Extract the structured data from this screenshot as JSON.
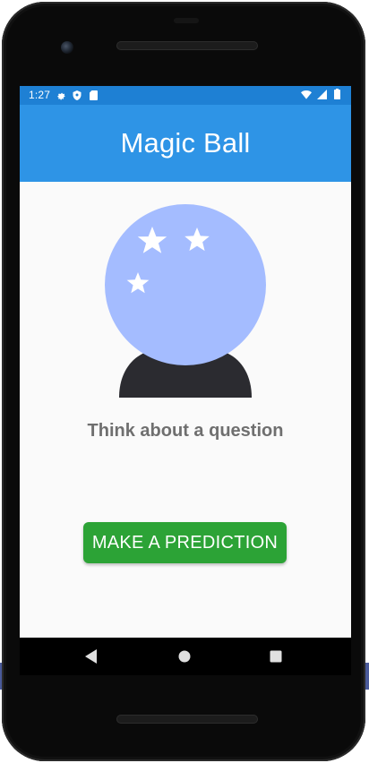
{
  "status_bar": {
    "time": "1:27",
    "left_icons": [
      "gear-icon",
      "shield-icon",
      "sd-card-icon"
    ],
    "right_icons": [
      "wifi-icon",
      "cell-signal-icon",
      "battery-icon"
    ]
  },
  "app_bar": {
    "title": "Magic Ball"
  },
  "main": {
    "image_icon": "crystal-ball-icon",
    "prompt": "Think about a question",
    "prediction_button_label": "MAKE A PREDICTION"
  },
  "nav_bar": {
    "buttons": [
      "back-icon",
      "home-icon",
      "recents-icon"
    ]
  },
  "colors": {
    "status_bar": "#1e80d4",
    "app_bar": "#2e94e6",
    "ball": "#a4bcff",
    "ball_stand": "#2b2b30",
    "button": "#2ca336",
    "prompt_text": "#6f6f6f",
    "background": "#fafafa"
  }
}
